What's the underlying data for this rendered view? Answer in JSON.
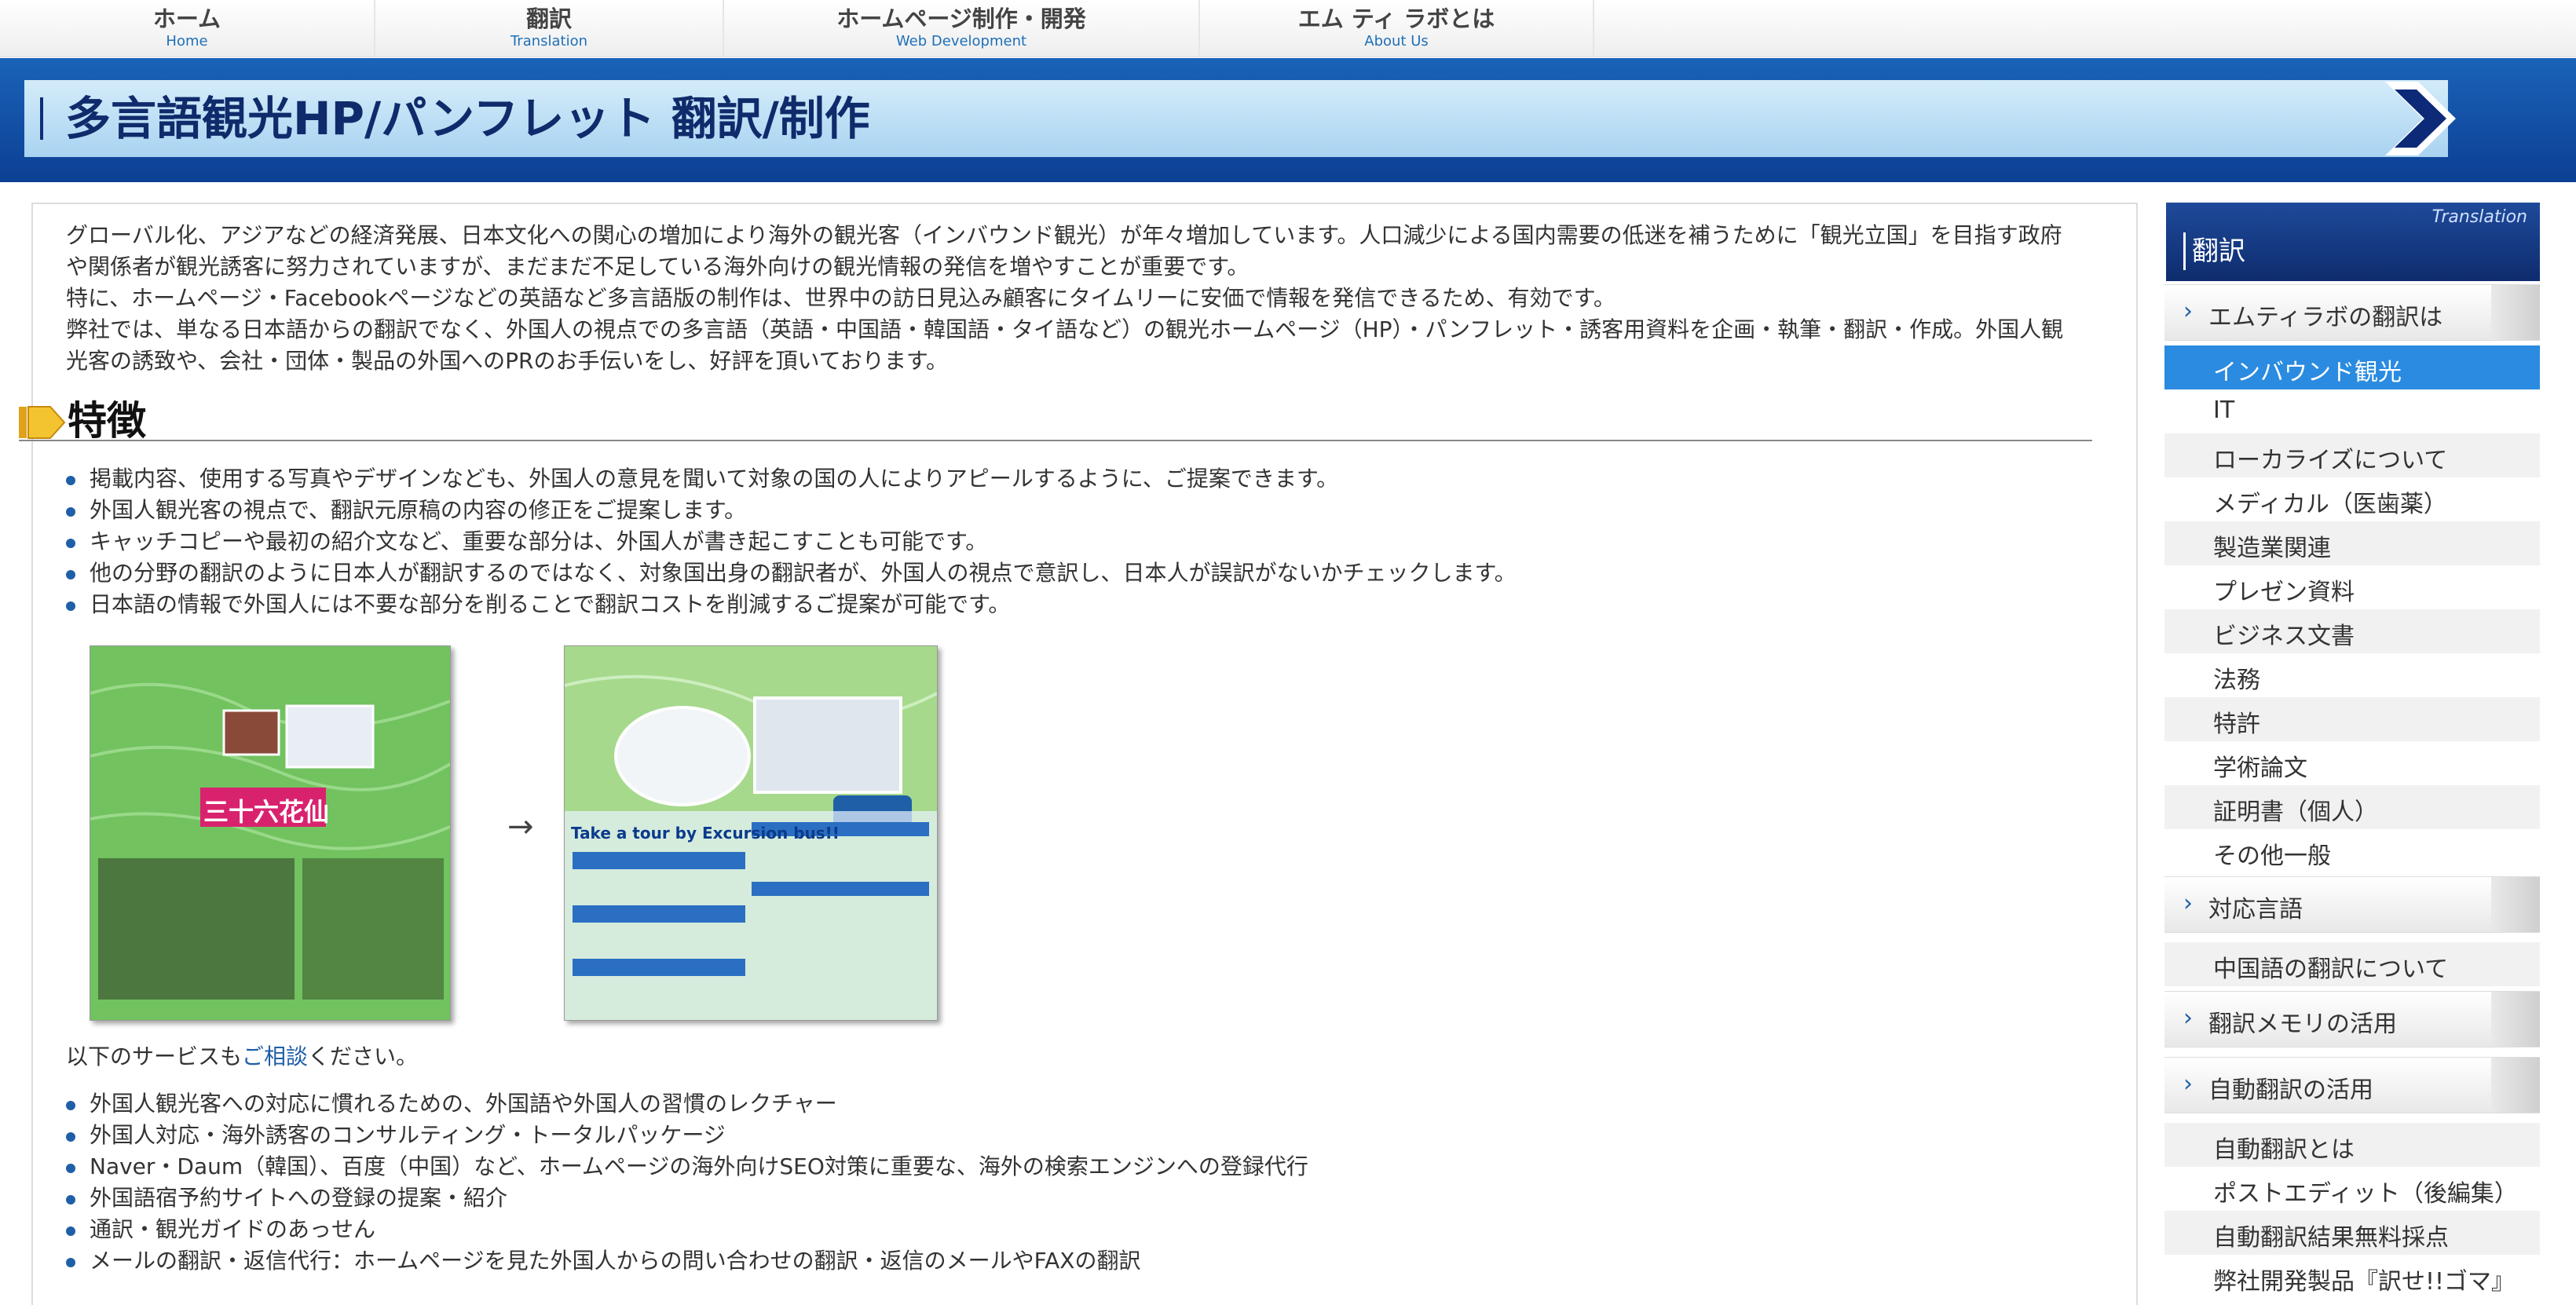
{
  "nav": [
    {
      "main": "ホーム",
      "sub": "Home"
    },
    {
      "main": "翻訳",
      "sub": "Translation"
    },
    {
      "main": "ホームページ制作・開発",
      "sub": "Web Development"
    },
    {
      "main": "エム ティ ラボとは",
      "sub": "About Us"
    }
  ],
  "page_title": "多言語観光HP/パンフレット 翻訳/制作",
  "intro": [
    "グローバル化、アジアなどの経済発展、日本文化への関心の増加により海外の観光客（インバウンド観光）が年々増加しています。人口減少による国内需要の低迷を補うために「観光立国」を目指す政府",
    "や関係者が観光誘客に努力されていますが、まだまだ不足している海外向けの観光情報の発信を増やすことが重要です。",
    "特に、ホームページ・Facebookページなどの英語など多言語版の制作は、世界中の訪日見込み顧客にタイムリーに安価で情報を発信できるため、有効です。",
    "弊社では、単なる日本語からの翻訳でなく、外国人の視点での多言語（英語・中国語・韓国語・タイ語など）の観光ホームページ（HP）・パンフレット・誘客用資料を企画・執筆・翻訳・作成。外国人観",
    "光客の誘致や、会社・団体・製品の外国へのPRのお手伝いをし、好評を頂いております。"
  ],
  "features_title": "特徴",
  "features": [
    "掲載内容、使用する写真やデザインなども、外国人の意見を聞いて対象の国の人によりアピールするように、ご提案できます。",
    "外国人観光客の視点で、翻訳元原稿の内容の修正をご提案します。",
    "キャッチコピーや最初の紹介文など、重要な部分は、外国人が書き起こすことも可能です。",
    "他の分野の翻訳のように日本人が翻訳するのではなく、対象国出身の翻訳者が、外国人の視点で意訳し、日本人が誤訳がないかチェックします。",
    "日本語の情報で外国人には不要な部分を削ることで翻訳コストを削減するご提案が可能です。"
  ],
  "pamphlet": {
    "before_title": "三十六花仙",
    "arrow": "→",
    "after_title": "Take a tour by Excursion bus!!"
  },
  "more_services": {
    "prefix": "以下のサービスも",
    "link": "ご相談",
    "suffix": "ください。"
  },
  "services": [
    "外国人観光客への対応に慣れるための、外国語や外国人の習慣のレクチャー",
    "外国人対応・海外誘客のコンサルティング・トータルパッケージ",
    "Naver・Daum（韓国）、百度（中国）など、ホームページの海外向けSEO対策に重要な、海外の検索エンジンへの登録代行",
    "外国語宿予約サイトへの登録の提案・紹介",
    "通訳・観光ガイドのあっせん",
    "メールの翻訳・返信代行：ホームページを見た外国人からの問い合わせの翻訳・返信のメールやFAXの翻訳"
  ],
  "sidebar": {
    "header_en": "Translation",
    "header_jp": "翻訳",
    "sections": [
      {
        "label": "エムティラボの翻訳は",
        "items": [
          "インバウンド観光",
          "IT",
          "ローカライズについて",
          "メディカル（医歯薬）",
          "製造業関連",
          "プレゼン資料",
          "ビジネス文書",
          "法務",
          "特許",
          "学術論文",
          "証明書（個人）",
          "その他一般"
        ]
      },
      {
        "label": "対応言語",
        "items": [
          "中国語の翻訳について"
        ]
      },
      {
        "label": "翻訳メモリの活用",
        "items": []
      },
      {
        "label": "自動翻訳の活用",
        "items": [
          "自動翻訳とは",
          "ポストエディット（後編集）",
          "自動翻訳結果無料採点",
          "弊社開発製品『訳せ!!ゴマ』"
        ]
      }
    ]
  },
  "colors": {
    "nav_sub": "#1e6fb8",
    "title_band": "#0c3f94",
    "title_bar": "#bfe0f6",
    "active_item": "#2a8be0",
    "bullet": "#1f5fa8"
  }
}
